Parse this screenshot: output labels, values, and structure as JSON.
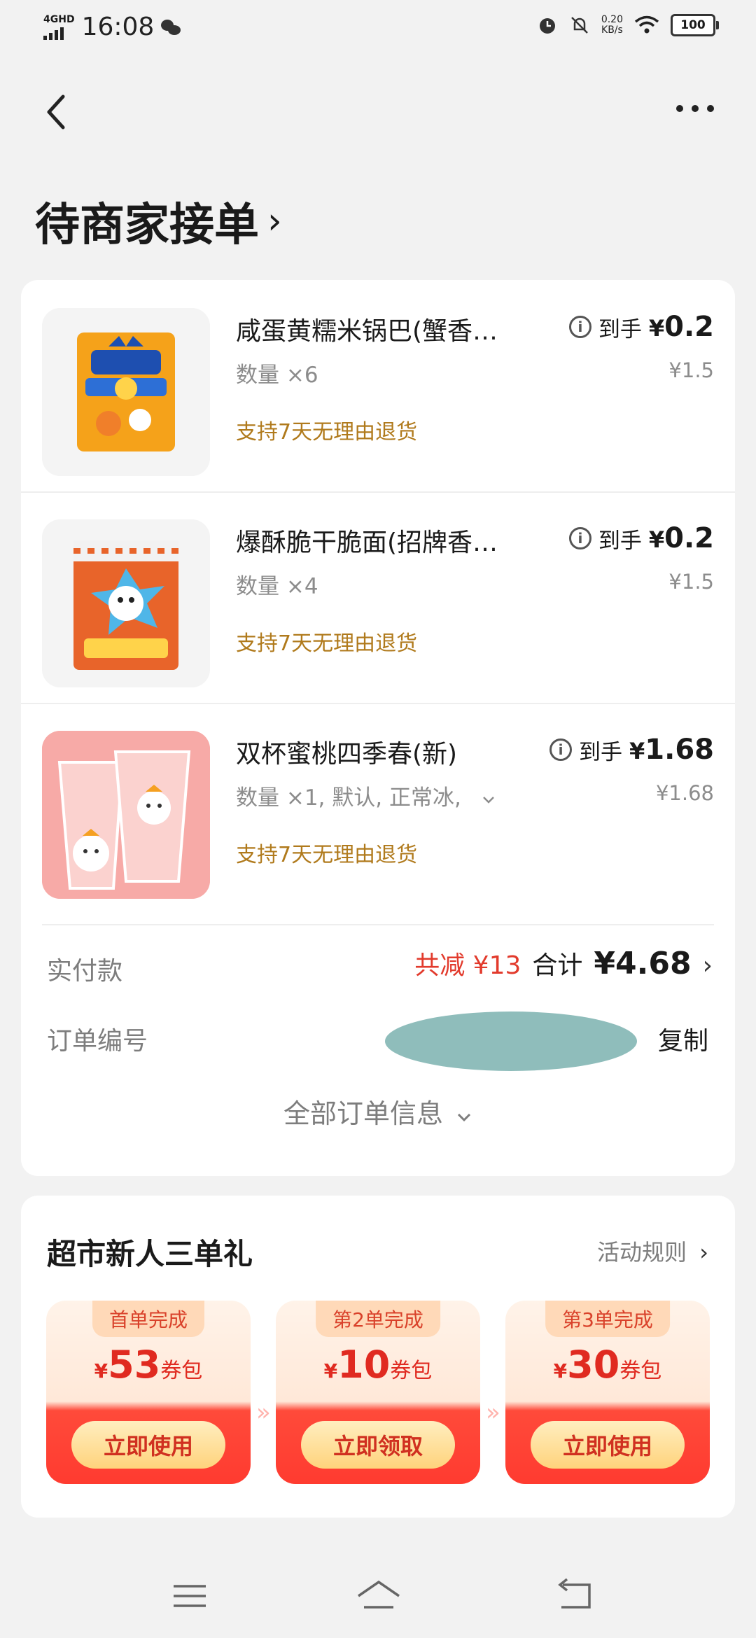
{
  "status_bar": {
    "network": "4GHD",
    "time": "16:08",
    "speed_value": "0.20",
    "speed_unit": "KB/s",
    "battery": "100"
  },
  "page": {
    "title": "待商家接单",
    "title_chevron": "›"
  },
  "items": [
    {
      "name": "咸蛋黄糯米锅巴(蟹香…",
      "qty": "数量 ×6",
      "return_policy": "支持7天无理由退货",
      "price_label": "到手",
      "currency": "¥",
      "price": "0.2",
      "original_price": "¥1.5"
    },
    {
      "name": "爆酥脆干脆面(招牌香…",
      "qty": "数量 ×4",
      "return_policy": "支持7天无理由退货",
      "price_label": "到手",
      "currency": "¥",
      "price": "0.2",
      "original_price": "¥1.5"
    },
    {
      "name": "双杯蜜桃四季春(新)",
      "qty": "数量 ×1, 默认, 正常冰,",
      "return_policy": "支持7天无理由退货",
      "price_label": "到手",
      "currency": "¥",
      "price": "1.68",
      "original_price": "¥1.68"
    }
  ],
  "summary": {
    "paid_label": "实付款",
    "discount": "共减 ¥13",
    "total_label": "合计",
    "total": "¥4.68",
    "order_no_label": "订单编号",
    "copy": "复制",
    "all_info": "全部订单信息"
  },
  "promo": {
    "title": "超市新人三单礼",
    "rules": "活动规则",
    "coupons": [
      {
        "tag": "首单完成",
        "amount": "53",
        "unit": "券包",
        "button": "立即使用"
      },
      {
        "tag": "第2单完成",
        "amount": "10",
        "unit": "券包",
        "button": "立即领取"
      },
      {
        "tag": "第3单完成",
        "amount": "30",
        "unit": "券包",
        "button": "立即使用"
      }
    ],
    "currency": "¥"
  },
  "colors": {
    "accent_red": "#e23a2c",
    "return_gold": "#b07a1c",
    "background": "#f2f2f2"
  },
  "icons": [
    "back-icon",
    "more-icon",
    "info-icon",
    "chevron-right-icon",
    "chevron-down-icon",
    "menu-icon",
    "home-icon",
    "return-icon"
  ]
}
